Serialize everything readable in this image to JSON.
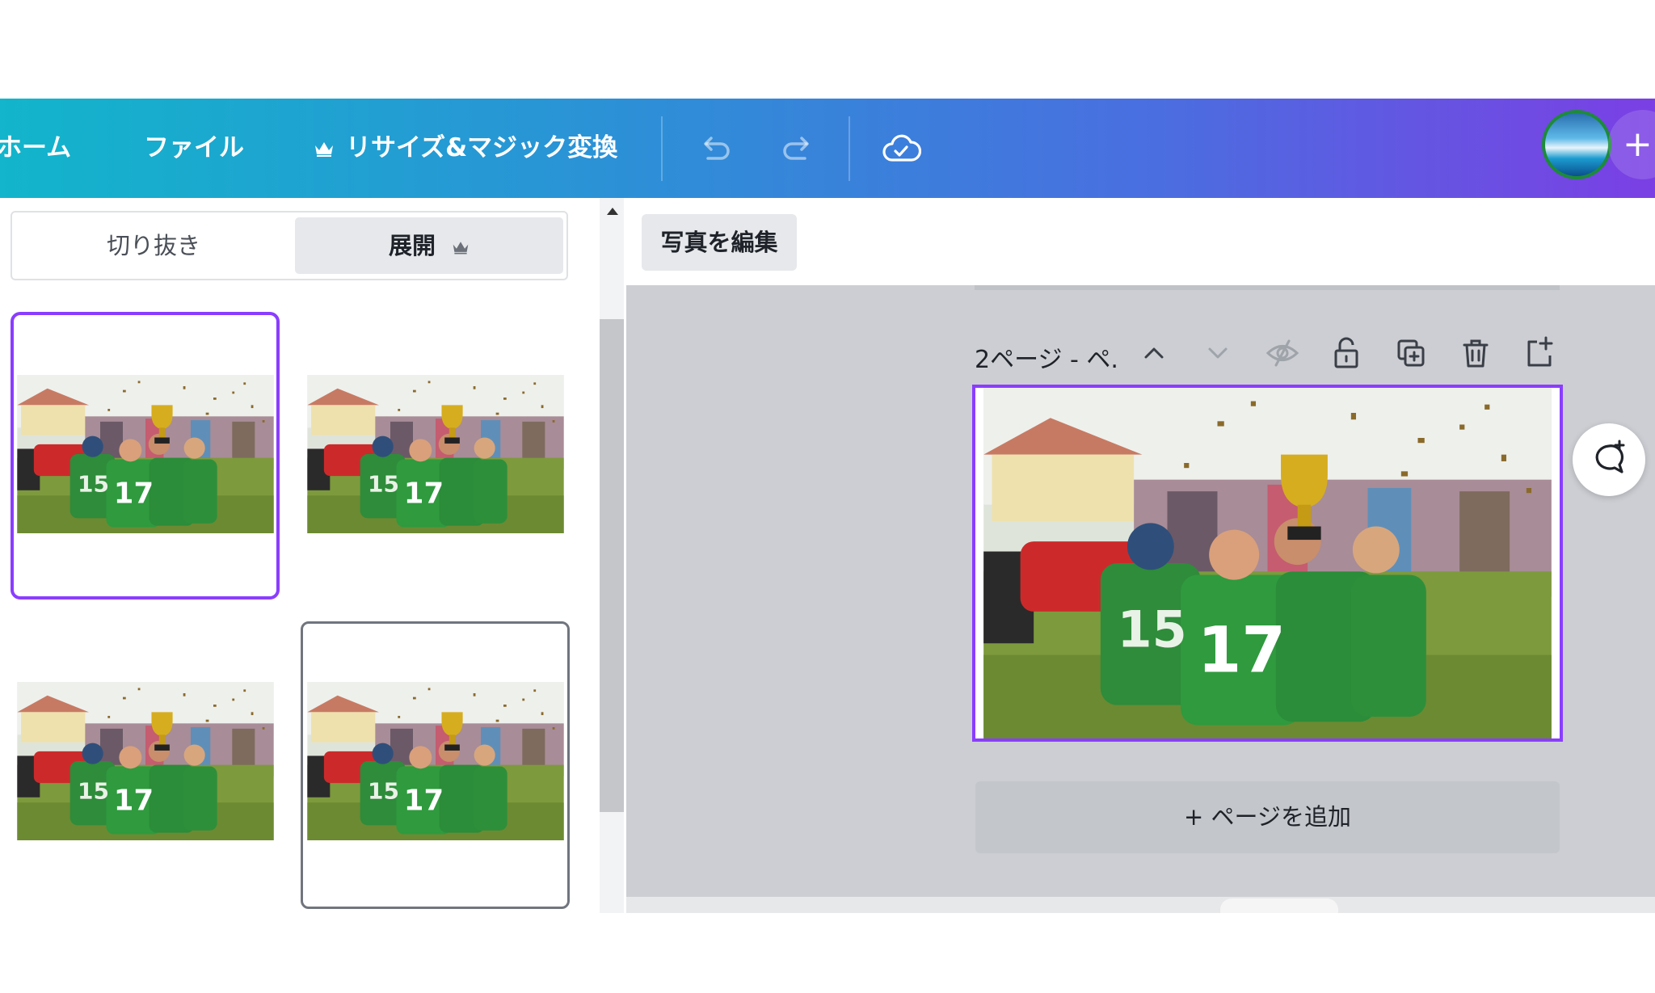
{
  "topbar": {
    "home_label": "ホーム",
    "file_label": "ファイル",
    "resize_label": "リサイズ&マジック変換",
    "icons": [
      "crown-icon",
      "undo-icon",
      "redo-icon",
      "cloud-saved-icon",
      "avatar",
      "plus-icon"
    ],
    "colors": {
      "gradient_start": "#12b5cb",
      "gradient_end": "#7b3fe4"
    }
  },
  "panel": {
    "crop_tab": "切り抜き",
    "expand_tab": "展開",
    "selected_thumbnail": 1
  },
  "editor": {
    "edit_photo_label": "写真を編集",
    "page_label": "2ページ - ペ.",
    "add_page_label": "+ ページを追加",
    "page_icons": [
      "chevron-up-icon",
      "chevron-down-icon",
      "hide-icon",
      "lock-icon",
      "duplicate-icon",
      "trash-icon",
      "add-page-icon"
    ],
    "selection_color": "#8b3dff"
  }
}
